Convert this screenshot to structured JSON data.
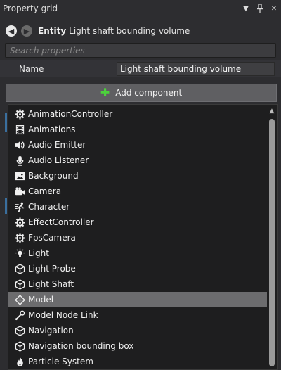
{
  "panel": {
    "title": "Property grid",
    "dropdown_icon": "triangle-down-icon",
    "pin_icon": "pin-icon",
    "close_icon": "close-icon"
  },
  "entity": {
    "label": "Entity",
    "name": "Light shaft bounding volume"
  },
  "search": {
    "placeholder": "Search properties",
    "value": ""
  },
  "name_row": {
    "label": "Name",
    "value": "Light shaft bounding volume"
  },
  "add_component": {
    "label": "Add component",
    "icon": "plus-icon",
    "icon_color": "#4cd23c"
  },
  "components": [
    {
      "label": "AnimationController",
      "icon": "gear-icon"
    },
    {
      "label": "Animations",
      "icon": "film-icon"
    },
    {
      "label": "Audio Emitter",
      "icon": "speaker-icon"
    },
    {
      "label": "Audio Listener",
      "icon": "microphone-icon"
    },
    {
      "label": "Background",
      "icon": "image-icon"
    },
    {
      "label": "Camera",
      "icon": "camera-icon"
    },
    {
      "label": "Character",
      "icon": "character-icon"
    },
    {
      "label": "EffectController",
      "icon": "gear-icon"
    },
    {
      "label": "FpsCamera",
      "icon": "gear-icon"
    },
    {
      "label": "Light",
      "icon": "light-icon"
    },
    {
      "label": "Light Probe",
      "icon": "cube-icon"
    },
    {
      "label": "Light Shaft",
      "icon": "cube-icon"
    },
    {
      "label": "Model",
      "icon": "model-icon",
      "selected": true
    },
    {
      "label": "Model Node Link",
      "icon": "link-icon"
    },
    {
      "label": "Navigation",
      "icon": "cube-icon"
    },
    {
      "label": "Navigation bounding box",
      "icon": "cube-icon"
    },
    {
      "label": "Particle System",
      "icon": "flame-icon"
    }
  ],
  "colors": {
    "background": "#2d2d30",
    "dropdown_bg": "#1e1e1f",
    "selected_bg": "#6c6c6e"
  }
}
